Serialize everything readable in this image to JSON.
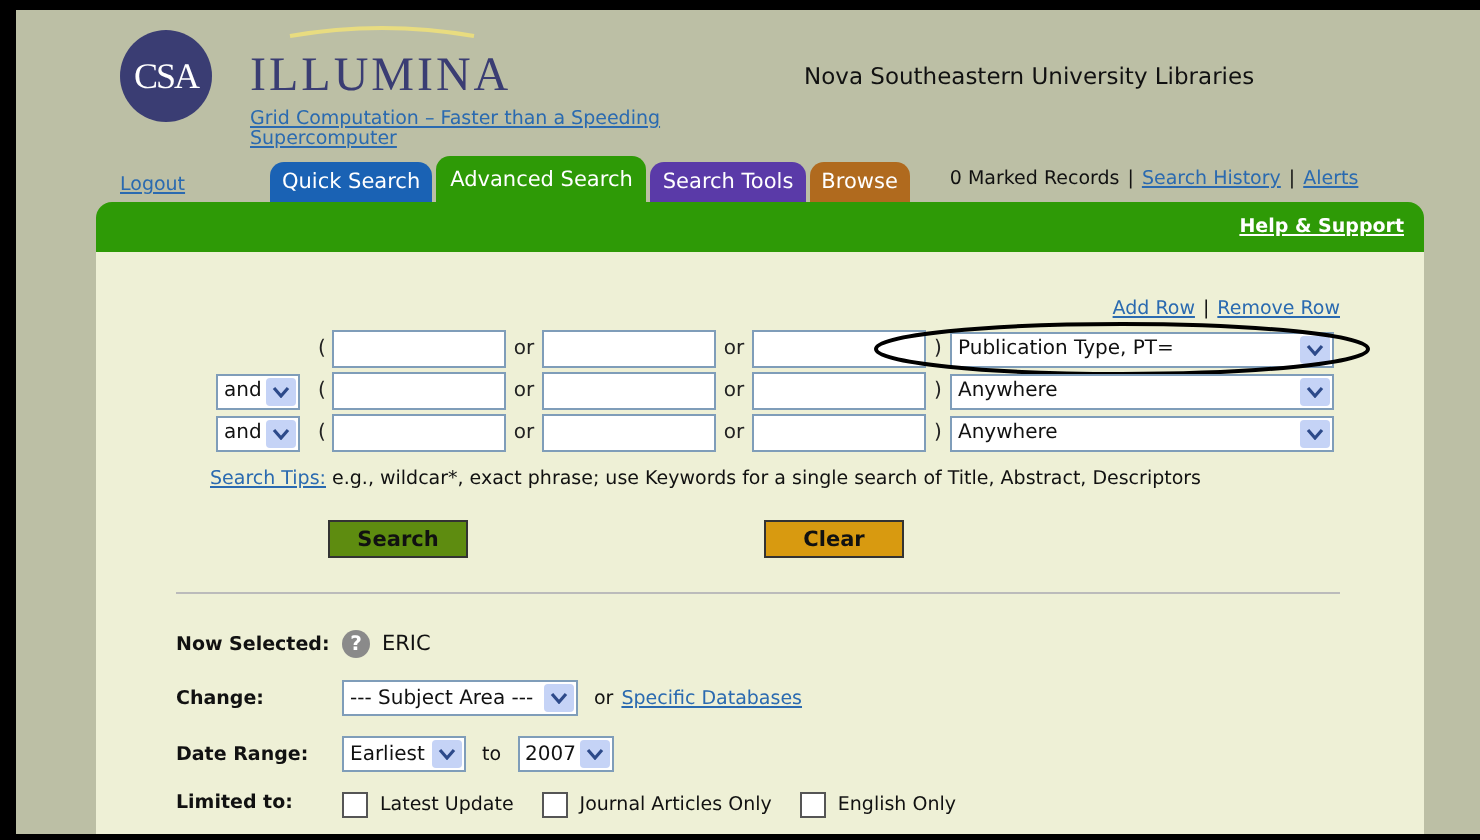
{
  "header": {
    "logo_badge": "CSA",
    "product": "ILLUMINA",
    "tagline": "Grid Computation – Faster than a Speeding Supercomputer",
    "institution": "Nova Southeastern University Libraries"
  },
  "logout": "Logout",
  "tabs": [
    {
      "label": "Quick Search",
      "selected": false,
      "color": "#1a62b4"
    },
    {
      "label": "Advanced Search",
      "selected": true,
      "color": "#2e9a06"
    },
    {
      "label": "Search Tools",
      "selected": false,
      "color": "#5a3aa8"
    },
    {
      "label": "Browse",
      "selected": false,
      "color": "#b06a1e"
    }
  ],
  "marked_records": "0 Marked Records",
  "top_links": [
    {
      "separator": "|",
      "label": "Search History"
    },
    {
      "separator": "|",
      "label": "Alerts"
    }
  ],
  "help_link": "Help & Support",
  "row_links": {
    "add": "Add Row",
    "separator": "|",
    "remove": "Remove Row"
  },
  "query_rows": [
    {
      "operator": null,
      "open": "(",
      "or_labels": [
        "or",
        "or"
      ],
      "close": ")",
      "field": "Publication Type, PT=",
      "highlighted": true
    },
    {
      "operator": "and",
      "open": "(",
      "or_labels": [
        "or",
        "or"
      ],
      "close": ")",
      "field": "Anywhere",
      "highlighted": false
    },
    {
      "operator": "and",
      "open": "(",
      "or_labels": [
        "or",
        "or"
      ],
      "close": ")",
      "field": "Anywhere",
      "highlighted": false
    }
  ],
  "search_tips": {
    "link": "Search Tips:",
    "text": "e.g., wildcar*, exact phrase; use Keywords for a single search of Title, Abstract, Descriptors"
  },
  "buttons": [
    {
      "label": "Search",
      "kind": "primary"
    },
    {
      "label": "Clear",
      "kind": "secondary"
    }
  ],
  "now_selected": {
    "label": "Now Selected:",
    "help_icon": "?",
    "value": "ERIC"
  },
  "change": {
    "label": "Change:",
    "select": "--- Subject Area ---",
    "or": "or",
    "link": "Specific Databases"
  },
  "date_range": {
    "label": "Date Range:",
    "from": "Earliest",
    "to_label": "to",
    "to": "2007"
  },
  "limited_to": {
    "label": "Limited to:",
    "options": [
      {
        "label": "Latest Update",
        "checked": false
      },
      {
        "label": "Journal Articles Only",
        "checked": false
      },
      {
        "label": "English Only",
        "checked": false
      }
    ]
  }
}
